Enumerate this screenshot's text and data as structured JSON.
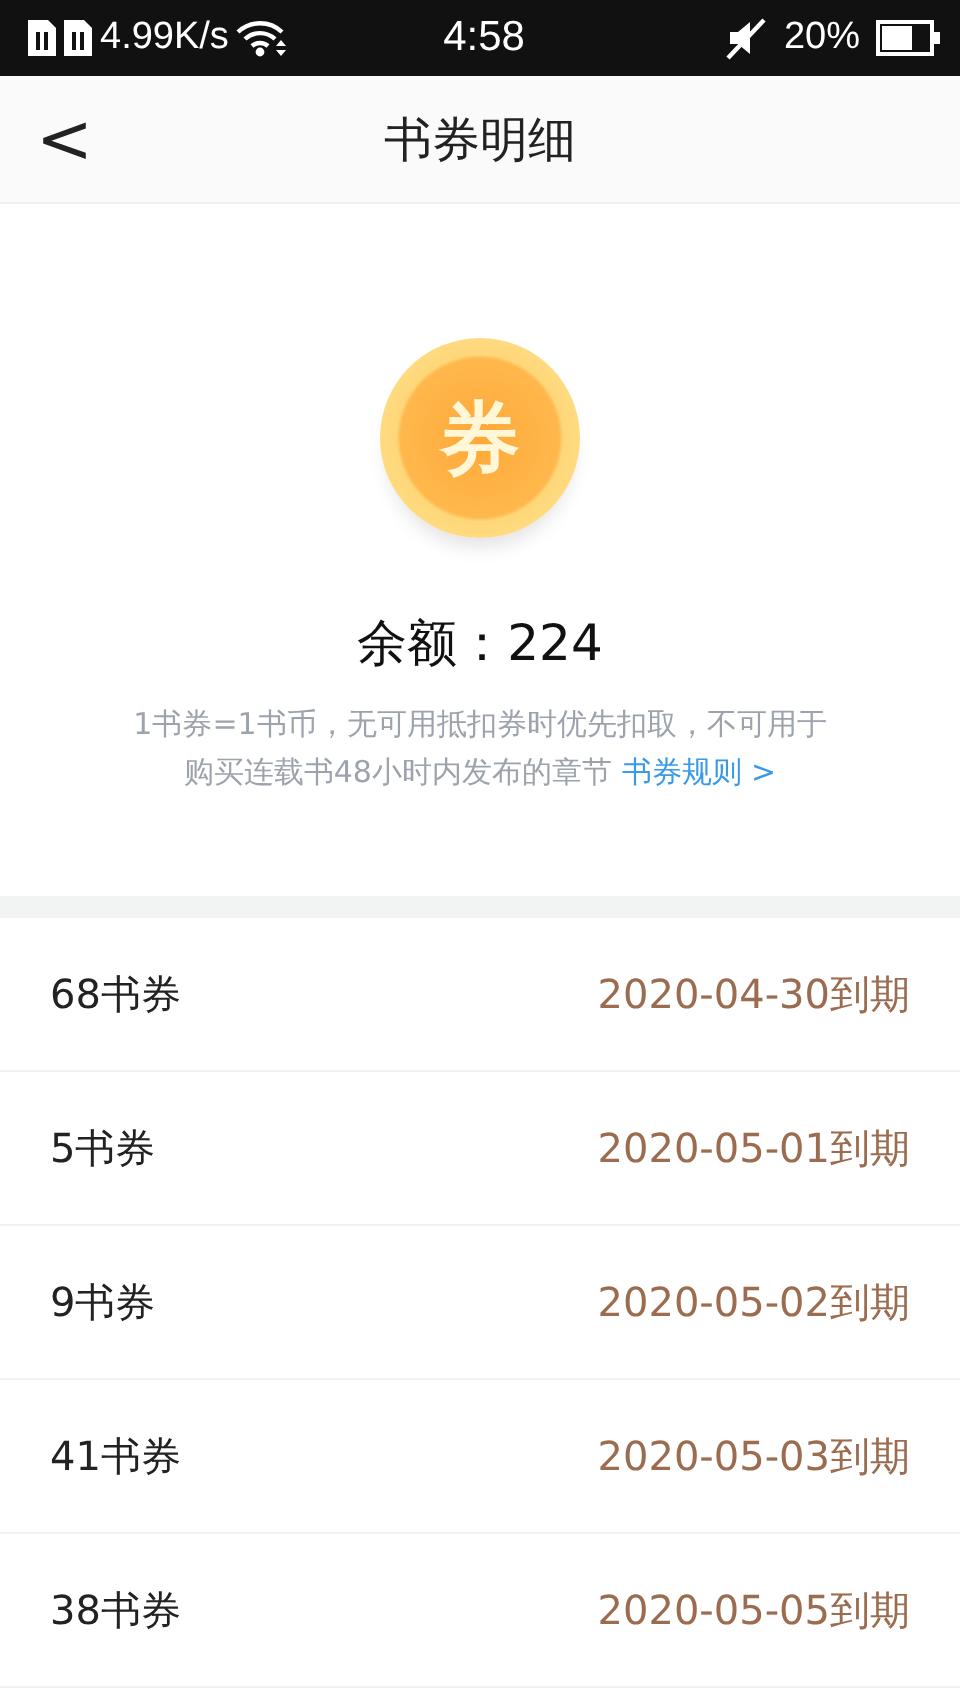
{
  "status_bar": {
    "speed": "4.99K/s",
    "time": "4:58",
    "battery": "20%"
  },
  "nav": {
    "back": "<",
    "title": "书券明细"
  },
  "balance": {
    "coin_glyph": "券",
    "label": "余额：224",
    "note": "1书券=1书币，无可用抵扣券时优先扣取，不可用于购买连载书48小时内发布的章节",
    "rules_link": "书券规则 >"
  },
  "vouchers": [
    {
      "amount": "68书券",
      "expiry": "2020-04-30到期"
    },
    {
      "amount": "5书券",
      "expiry": "2020-05-01到期"
    },
    {
      "amount": "9书券",
      "expiry": "2020-05-02到期"
    },
    {
      "amount": "41书券",
      "expiry": "2020-05-03到期"
    },
    {
      "amount": "38书券",
      "expiry": "2020-05-05到期"
    }
  ]
}
